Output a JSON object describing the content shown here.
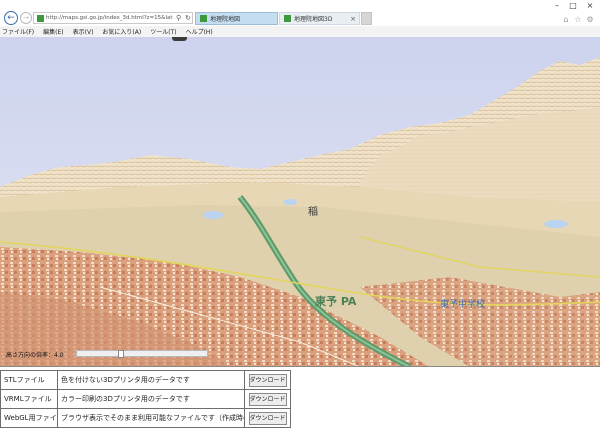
{
  "browser": {
    "url": "http://maps.gsi.go.jp/index_3d.html?z=15&lat=...",
    "tabs": [
      {
        "label": "地理院地図"
      },
      {
        "label": "地理院地図3D"
      }
    ],
    "menu": [
      "ファイル(F)",
      "編集(E)",
      "表示(V)",
      "お気に入り(A)",
      "ツール(T)",
      "ヘルプ(H)"
    ]
  },
  "map": {
    "labels": [
      "稲",
      "東予 PA",
      "東予中学校"
    ],
    "scale": {
      "label": "高さ方向の倍率：4.0",
      "value": 4.0,
      "min": 1,
      "max": 10
    }
  },
  "downloads": [
    {
      "format": "STLファイル",
      "description": "色を付けない3Dプリンタ用のデータです",
      "button": "ダウンロード"
    },
    {
      "format": "VRMLファイル",
      "description": "カラー印刷の3Dプリンタ用のデータです",
      "button": "ダウンロード"
    },
    {
      "format": "WebGL用ファイル",
      "description": "ブラウザ表示でそのまま利用可能なファイルです（作成時の地図が必要です）",
      "button": "ダウンロード"
    }
  ],
  "colors": {
    "sky": "#d2d7ee",
    "terrain_light": "#efe4cf",
    "urban": "#dca383",
    "highway": "#6a9a72",
    "tab_active": "#c4ddf0"
  }
}
